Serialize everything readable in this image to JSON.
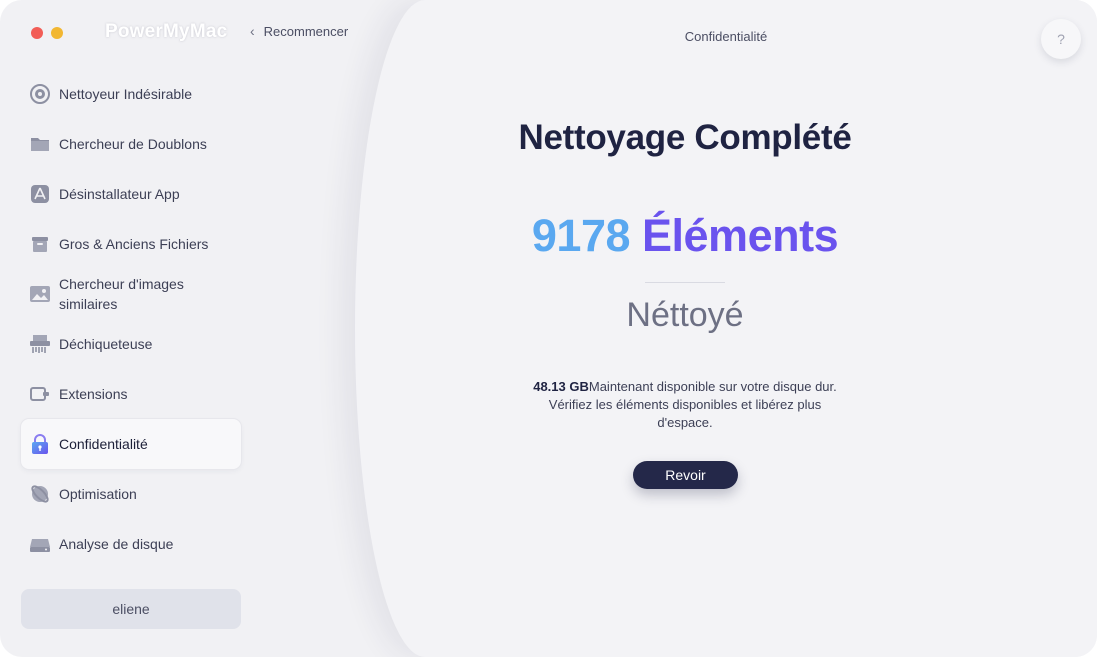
{
  "app": {
    "name": "PowerMyMac",
    "restart_label": "Recommencer",
    "page_title": "Confidentialité",
    "help_label": "?"
  },
  "sidebar": {
    "items": [
      {
        "label": "Nettoyeur Indésirable",
        "icon": "junk-cleaner-icon"
      },
      {
        "label": "Chercheur de Doublons",
        "icon": "folder-icon"
      },
      {
        "label": "Désinstallateur App",
        "icon": "app-uninstaller-icon"
      },
      {
        "label": "Gros & Anciens Fichiers",
        "icon": "box-icon"
      },
      {
        "label": "Chercheur d'images similaires",
        "icon": "image-icon"
      },
      {
        "label": "Déchiqueteuse",
        "icon": "shredder-icon"
      },
      {
        "label": "Extensions",
        "icon": "extensions-icon"
      },
      {
        "label": "Confidentialité",
        "icon": "lock-icon",
        "active": true
      },
      {
        "label": "Optimisation",
        "icon": "optimization-icon"
      },
      {
        "label": "Analyse de disque",
        "icon": "disk-icon"
      }
    ],
    "user": "eliene"
  },
  "result": {
    "headline": "Nettoyage Complété",
    "count_number": "9178",
    "count_word": "Éléments",
    "cleaned_label": "Néttoyé",
    "size": "48.13 GB",
    "description": "Maintenant disponible sur votre disque dur. Vérifiez les éléments disponibles et libérez plus d'espace.",
    "review_button": "Revoir"
  },
  "colors": {
    "count_number": "#5aa8f0",
    "count_word": "#6a53ee",
    "button": "#242849",
    "traffic_red": "#f25d56",
    "traffic_yellow": "#f2b732"
  }
}
